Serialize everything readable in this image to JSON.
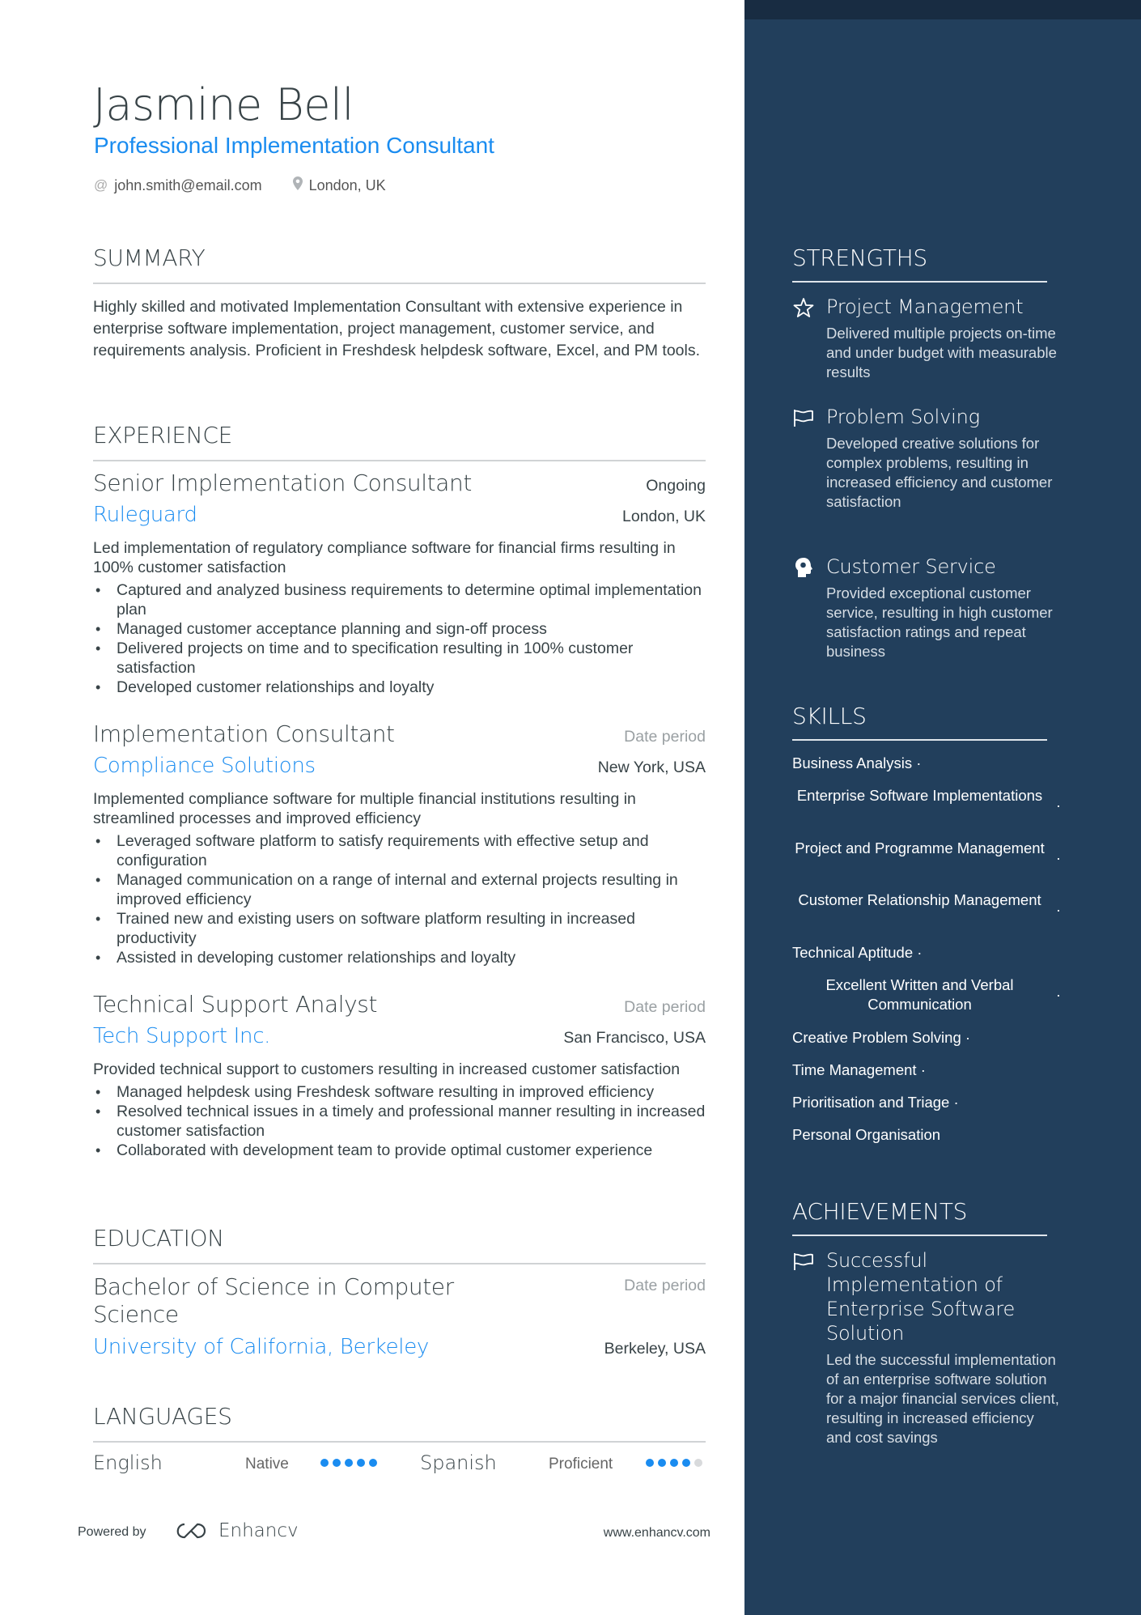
{
  "header": {
    "name": "Jasmine Bell",
    "title": "Professional Implementation Consultant",
    "email": "john.smith@email.com",
    "location": "London, UK",
    "email_icon": "at-icon",
    "location_icon": "map-pin-icon"
  },
  "sections": {
    "summary": "SUMMARY",
    "experience": "EXPERIENCE",
    "education": "EDUCATION",
    "languages": "LANGUAGES",
    "strengths": "STRENGTHS",
    "skills": "SKILLS",
    "achievements": "ACHIEVEMENTS"
  },
  "summary": "Highly skilled and motivated Implementation Consultant with extensive experience in enterprise software implementation, project management, customer service, and requirements analysis. Proficient in Freshdesk helpdesk software, Excel, and PM tools.",
  "experience": [
    {
      "title": "Senior Implementation Consultant",
      "date": "Ongoing",
      "company": "Ruleguard",
      "location": "London, UK",
      "description": "Led implementation of regulatory compliance software for financial firms resulting in 100% customer satisfaction",
      "bullets": [
        "Captured and analyzed business requirements to determine optimal implementation plan",
        "Managed customer acceptance planning and sign-off process",
        "Delivered projects on time and to specification resulting in 100% customer satisfaction",
        "Developed customer relationships and loyalty"
      ]
    },
    {
      "title": "Implementation Consultant",
      "date": "Date period",
      "company": "Compliance Solutions",
      "location": "New York, USA",
      "description": "Implemented compliance software for multiple financial institutions resulting in streamlined processes and improved efficiency",
      "bullets": [
        "Leveraged software platform to satisfy requirements with effective setup and configuration",
        "Managed communication on a range of internal and external projects resulting in improved efficiency",
        "Trained new and existing users on software platform resulting in increased productivity",
        "Assisted in developing customer relationships and loyalty"
      ]
    },
    {
      "title": "Technical Support Analyst",
      "date": "Date period",
      "company": "Tech Support Inc.",
      "location": "San Francisco, USA",
      "description": "Provided technical support to customers resulting in increased customer satisfaction",
      "bullets": [
        "Managed helpdesk using Freshdesk software resulting in improved efficiency",
        "Resolved technical issues in a timely and professional manner resulting in increased customer satisfaction",
        "Collaborated with development team to provide optimal customer experience"
      ]
    }
  ],
  "education": {
    "degree": "Bachelor of Science in Computer Science",
    "date": "Date period",
    "school": "University of California, Berkeley",
    "location": "Berkeley, USA"
  },
  "languages": [
    {
      "name": "English",
      "level": "Native",
      "rating": 5,
      "max": 5
    },
    {
      "name": "Spanish",
      "level": "Proficient",
      "rating": 4,
      "max": 5
    }
  ],
  "strengths": [
    {
      "icon": "star-icon",
      "title": "Project Management",
      "description": "Delivered multiple projects on-time and under budget with measurable results"
    },
    {
      "icon": "flag-icon",
      "title": "Problem Solving",
      "description": "Developed creative solutions for complex problems, resulting in increased efficiency and customer satisfaction"
    },
    {
      "icon": "head-icon",
      "title": "Customer Service",
      "description": "Provided exceptional customer service, resulting in high customer satisfaction ratings and repeat business"
    }
  ],
  "skills": [
    "Business Analysis",
    "Enterprise Software Implementations",
    "Project and Programme Management",
    "Customer Relationship Management",
    "Technical Aptitude",
    "Excellent Written and Verbal Communication",
    "Creative Problem Solving",
    "Time Management",
    "Prioritisation and Triage",
    "Personal Organisation"
  ],
  "skill_separator": "·",
  "achievements": [
    {
      "icon": "flag-icon",
      "title": "Successful Implementation of Enterprise Software Solution",
      "description": "Led the successful implementation of an enterprise software solution for a major financial services client, resulting in increased efficiency and cost savings"
    }
  ],
  "footer": {
    "powered_by": "Powered by",
    "brand": "Enhancv",
    "url": "www.enhancv.com"
  },
  "colors": {
    "accent": "#1a8cf0",
    "sidebar": "#223f5c",
    "sidebar_top": "#182c42",
    "text": "#384347"
  }
}
